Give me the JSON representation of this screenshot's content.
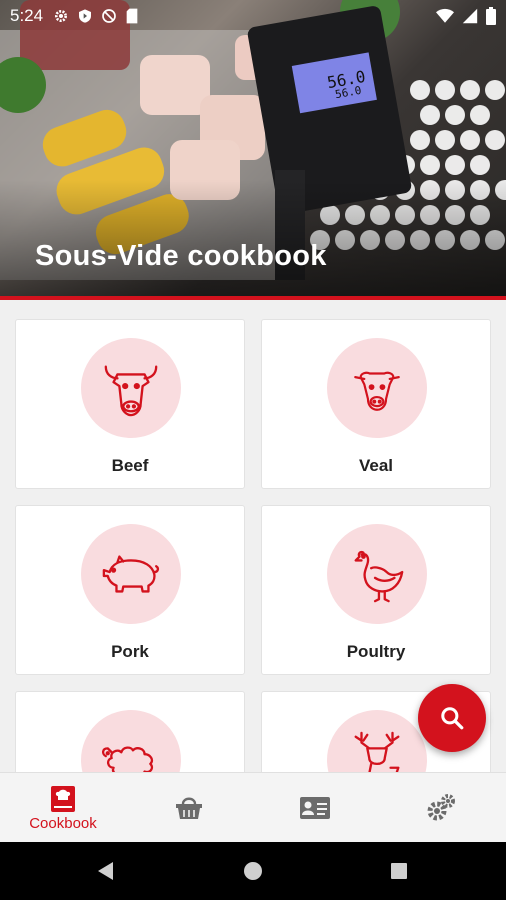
{
  "status_bar": {
    "time": "5:24"
  },
  "header": {
    "title": "Sous-Vide cookbook"
  },
  "categories": [
    {
      "label": "Beef",
      "icon": "cow-icon"
    },
    {
      "label": "Veal",
      "icon": "calf-icon"
    },
    {
      "label": "Pork",
      "icon": "pig-icon"
    },
    {
      "label": "Poultry",
      "icon": "chicken-icon"
    },
    {
      "label": "",
      "icon": "sheep-icon"
    },
    {
      "label": "",
      "icon": "deer-icon"
    }
  ],
  "device_display": {
    "reading_top": "56.0",
    "reading_bottom": "56.0"
  },
  "fab": {
    "icon": "search-icon"
  },
  "bottom_nav": [
    {
      "label": "Cookbook",
      "icon": "cookbook-icon",
      "active": true
    },
    {
      "label": "",
      "icon": "basket-icon",
      "active": false
    },
    {
      "label": "",
      "icon": "contact-card-icon",
      "active": false
    },
    {
      "label": "",
      "icon": "gears-icon",
      "active": false
    }
  ],
  "colors": {
    "accent": "#d3121d",
    "icon_bg": "#f9dcdf",
    "nav_inactive": "#6b6b6b"
  }
}
